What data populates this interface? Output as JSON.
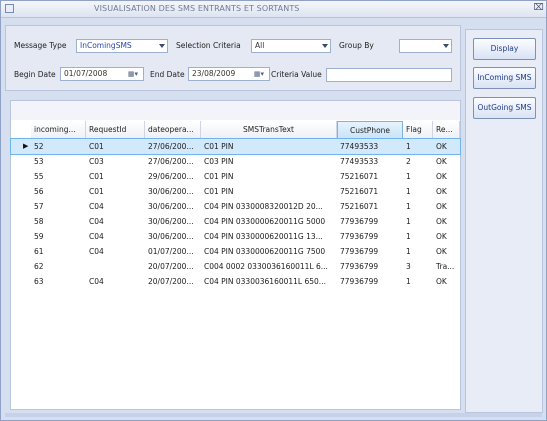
{
  "window": {
    "title": "VISUALISATION DES SMS ENTRANTS ET SORTANTS",
    "close_glyph": "⌧"
  },
  "filters": {
    "message_type_label": "Message  Type",
    "message_type_value": "InComingSMS",
    "selection_criteria_label": "Selection Criteria",
    "selection_criteria_value": "All",
    "group_by_label": "Group By",
    "group_by_value": "",
    "begin_date_label": "Begin Date",
    "begin_date_value": "01/07/2008",
    "end_date_label": "End Date",
    "end_date_value": "23/08/2009",
    "criteria_value_label": "Criteria Value",
    "criteria_value_value": ""
  },
  "buttons": {
    "display": "Display",
    "incoming": "InComing SMS",
    "outgoing": "OutGoing SMS"
  },
  "grid": {
    "columns": [
      "incoming...",
      "RequestId",
      "dateopera...",
      "SMSTransText",
      "CustPhone",
      "Flag",
      "Re..."
    ],
    "sorted_column": "CustPhone",
    "selected_row": 0,
    "rows": [
      [
        "52",
        "C01",
        "27/06/200...",
        "C01 PIN",
        "77493533",
        "1",
        "OK"
      ],
      [
        "53",
        "C03",
        "27/06/200...",
        "C03 PIN",
        "77493533",
        "2",
        "OK"
      ],
      [
        "55",
        "C01",
        "29/06/200...",
        "C01 PIN",
        "75216071",
        "1",
        "OK"
      ],
      [
        "56",
        "C01",
        "30/06/200...",
        "C01 PIN",
        "75216071",
        "1",
        "OK"
      ],
      [
        "57",
        "C04",
        "30/06/200...",
        "C04 PIN 0330008320012D 20...",
        "75216071",
        "1",
        "OK"
      ],
      [
        "58",
        "C04",
        "30/06/200...",
        "C04 PIN 0330000620011G 5000",
        "77936799",
        "1",
        "OK"
      ],
      [
        "59",
        "C04",
        "30/06/200...",
        "C04 PIN 0330000620011G 13...",
        "77936799",
        "1",
        "OK"
      ],
      [
        "61",
        "C04",
        "01/07/200...",
        "C04 PIN 0330000620011G 7500",
        "77936799",
        "1",
        "OK"
      ],
      [
        "62",
        "",
        "20/07/200...",
        "C004 0002 0330036160011L 6...",
        "77936799",
        "3",
        "Tra..."
      ],
      [
        "63",
        "C04",
        "20/07/200...",
        "C04 PIN 0330036160011L 650...",
        "77936799",
        "1",
        "OK"
      ]
    ]
  },
  "icons": {
    "row_indicator": "▶",
    "calendar": "▦▾"
  }
}
